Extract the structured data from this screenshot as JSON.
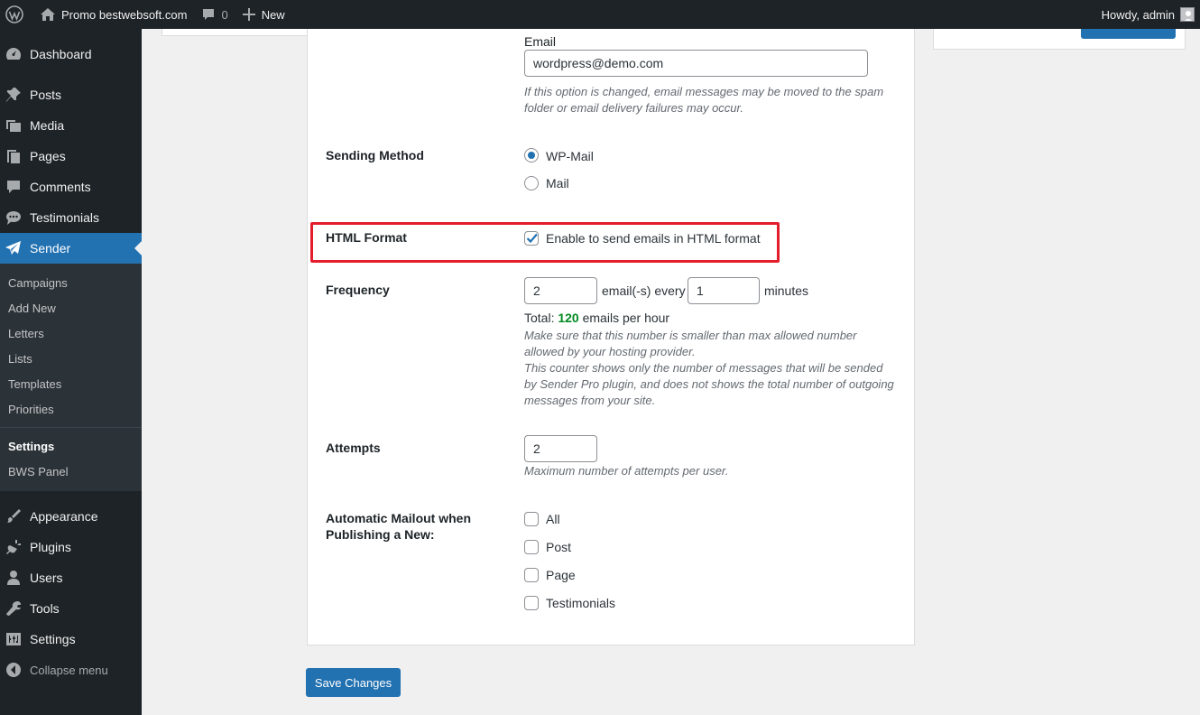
{
  "adminbar": {
    "site_name": "Promo bestwebsoft.com",
    "comments_count": "0",
    "new_label": "New",
    "howdy": "Howdy, admin"
  },
  "sidebar": {
    "items_top": [
      {
        "label": "Dashboard",
        "icon": "dashboard-icon"
      },
      {
        "label": "Posts",
        "icon": "pin-icon"
      },
      {
        "label": "Media",
        "icon": "media-icon"
      },
      {
        "label": "Pages",
        "icon": "pages-icon"
      },
      {
        "label": "Comments",
        "icon": "comment-icon"
      },
      {
        "label": "Testimonials",
        "icon": "speech-bubble-icon"
      },
      {
        "label": "Sender",
        "icon": "paper-plane-icon",
        "active": true
      }
    ],
    "submenu": [
      "Campaigns",
      "Add New",
      "Letters",
      "Lists",
      "Templates",
      "Priorities",
      "Settings",
      "BWS Panel"
    ],
    "submenu_current": "Settings",
    "items_bottom": [
      {
        "label": "Appearance",
        "icon": "brush-icon"
      },
      {
        "label": "Plugins",
        "icon": "plug-icon"
      },
      {
        "label": "Users",
        "icon": "user-icon"
      },
      {
        "label": "Tools",
        "icon": "wrench-icon"
      },
      {
        "label": "Settings",
        "icon": "sliders-icon"
      }
    ],
    "collapse_label": "Collapse menu"
  },
  "form": {
    "email": {
      "label": "Email",
      "value": "wordpress@demo.com",
      "description": "If this option is changed, email messages may be moved to the spam folder or email delivery failures may occur."
    },
    "sending_method": {
      "label": "Sending Method",
      "options": [
        "WP-Mail",
        "Mail"
      ],
      "selected": "WP-Mail"
    },
    "html_format": {
      "label": "HTML Format",
      "checkbox_label": "Enable to send emails in HTML format",
      "checked": true
    },
    "frequency": {
      "label": "Frequency",
      "emails_value": "2",
      "emails_every_label": "email(-s) every",
      "minutes_value": "1",
      "minutes_label": "minutes",
      "total_prefix": "Total:",
      "total_number": "120",
      "total_suffix": "emails per hour",
      "description_1": "Make sure that this number is smaller than max allowed number allowed by your hosting provider.",
      "description_2": "This counter shows only the number of messages that will be sended by Sender Pro plugin, and does not shows the total number of outgoing messages from your site."
    },
    "attempts": {
      "label": "Attempts",
      "value": "2",
      "description": "Maximum number of attempts per user."
    },
    "auto_mailout": {
      "label": "Automatic Mailout when Publishing a New:",
      "options": [
        "All",
        "Post",
        "Page",
        "Testimonials"
      ]
    }
  },
  "save_label": "Save Changes",
  "colors": {
    "accent": "#2271b1",
    "sidebar_bg": "#1d2327",
    "highlight": "#e31d2c",
    "total_green": "#008a20"
  }
}
